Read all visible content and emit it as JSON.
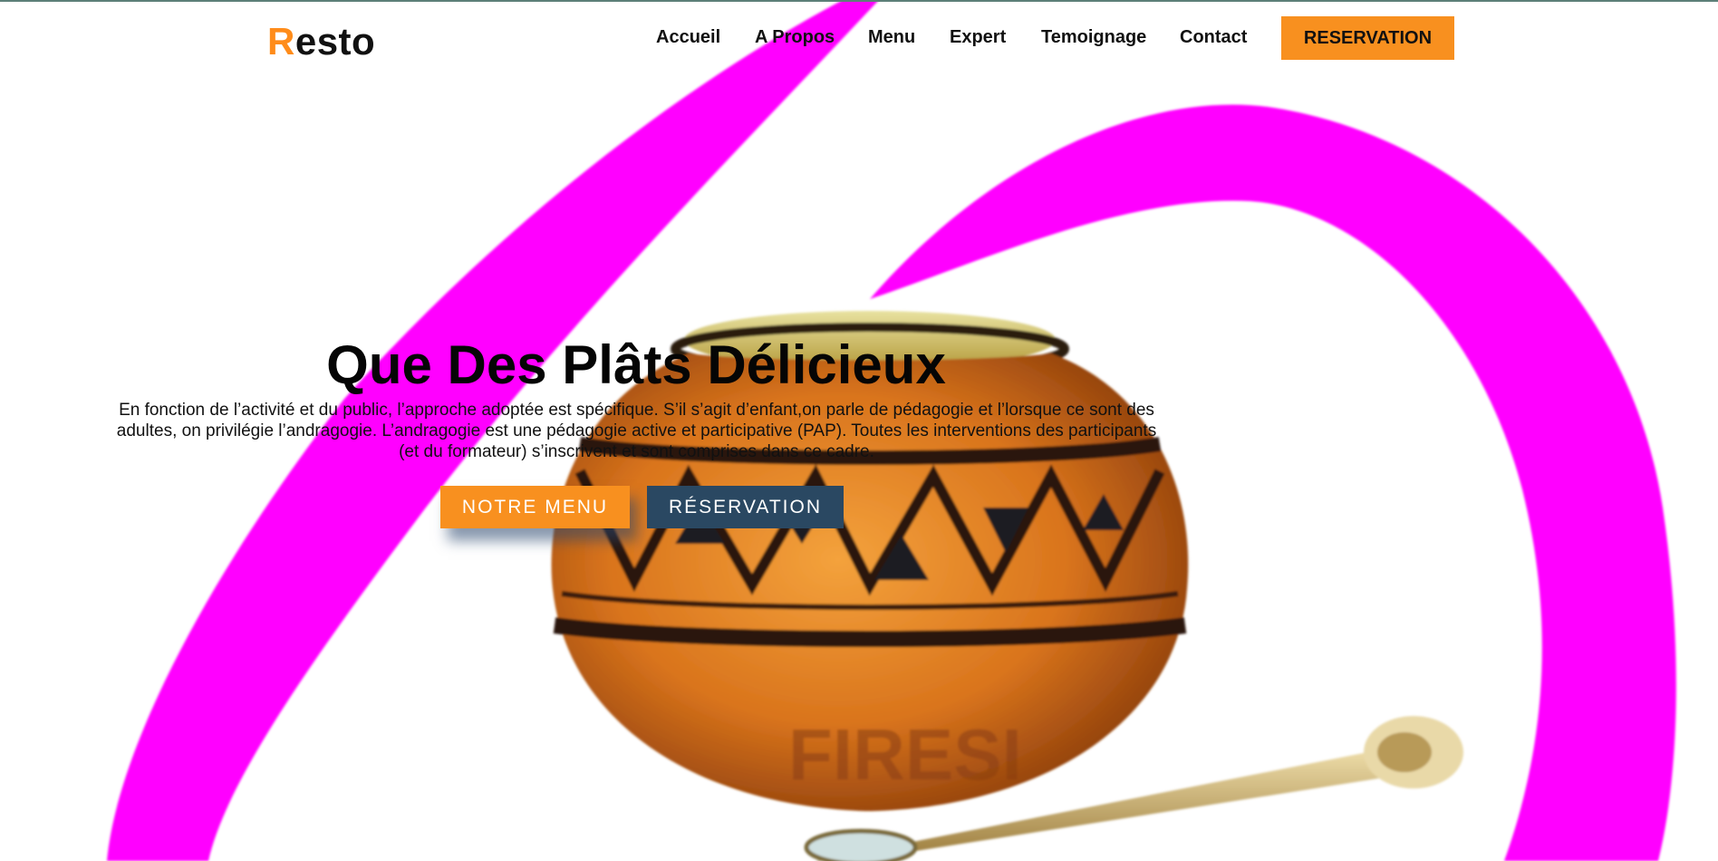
{
  "colors": {
    "accent": "#f8901f",
    "dark_button": "#2a4862",
    "swirl": "#ff00ff",
    "pot": "#d9741c"
  },
  "header": {
    "logo_first": "R",
    "logo_rest": "esto",
    "nav": [
      {
        "label": "Accueil"
      },
      {
        "label": "A Propos"
      },
      {
        "label": "Menu"
      },
      {
        "label": "Expert"
      },
      {
        "label": "Temoignage"
      },
      {
        "label": "Contact"
      }
    ],
    "reservation_label": "RESERVATION"
  },
  "hero": {
    "title": "Que Des Plâts Délicieux",
    "text": "En fonction de l’activité et du public, l’approche adoptée est spécifique. S’il s’agit d’enfant,on parle de pédagogie et l’lorsque ce sont des adultes, on privilégie l’andragogie. L’andragogie est une pédagogie active et participative (PAP). Toutes les interventions des participants (et du formateur) s’inscrivent et sont comprises dans ce cadre.",
    "menu_button": "NOTRE MENU",
    "reservation_button": "RÉSERVATION"
  },
  "background": {
    "image_icon": "pot-icon",
    "swirl_icon": "swirl-shape"
  }
}
